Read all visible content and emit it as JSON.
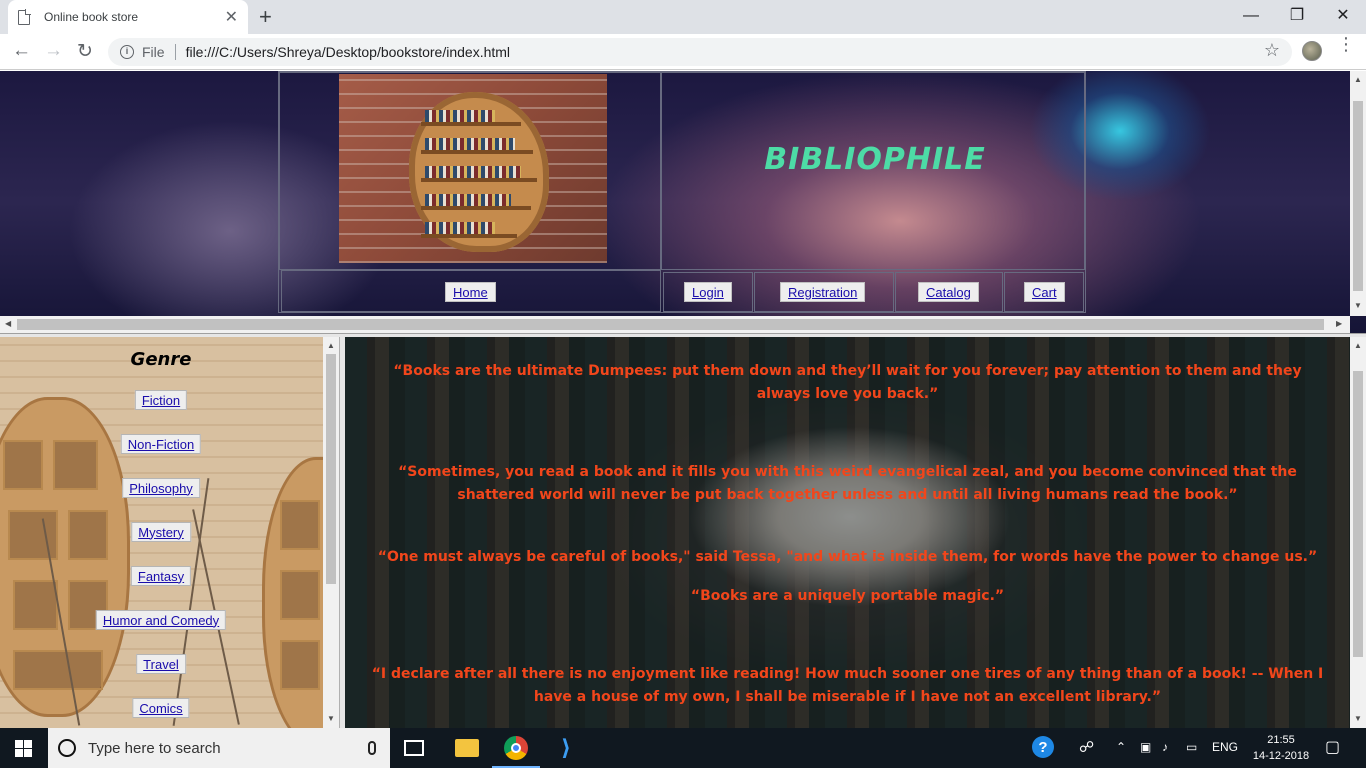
{
  "browser": {
    "tab_title": "Online book store",
    "tab_close": "✕",
    "new_tab": "+",
    "window_controls": {
      "minimize": "—",
      "restore": "❐",
      "close": "✕"
    },
    "nav": {
      "back": "←",
      "forward": "→",
      "reload": "↻"
    },
    "address": {
      "info": "i",
      "scheme_label": "File",
      "url": "file:///C:/Users/Shreya/Desktop/bookstore/index.html"
    },
    "bookmark_icon": "☆",
    "menu_icon": "⋮"
  },
  "header": {
    "site_title": "BIBLIOPHILE",
    "nav_buttons": [
      "Home",
      "Login",
      "Registration",
      "Catalog",
      "Cart"
    ]
  },
  "sidebar": {
    "title": "Genre",
    "genres": [
      "Fiction",
      "Non-Fiction",
      "Philosophy",
      "Mystery",
      "Fantasy",
      "Humor and Comedy",
      "Travel",
      "Comics"
    ]
  },
  "main": {
    "quotes": [
      "“Books are the ultimate Dumpees: put them down and they’ll wait for you forever; pay attention to them and they always love you back.”",
      "“Sometimes, you read a book and it fills you with this weird evangelical zeal, and you become convinced that the shattered world will never be put back together unless and until all living humans read the book.”",
      "“One must always be careful of books,\" said Tessa, \"and what is inside them, for words have the power to change us.”",
      "“Books are a uniquely portable magic.”",
      "“I declare after all there is no enjoyment like reading! How much sooner one tires of any thing than of a book! -- When I have a house of my own, I shall be miserable if I have not an excellent library.”"
    ]
  },
  "taskbar": {
    "search_placeholder": "Type here to search",
    "language": "ENG",
    "time": "21:55",
    "date": "14-12-2018"
  },
  "colors": {
    "title_green": "#4ddca6",
    "quote_red": "#f2461b",
    "link_blue": "#1a0dab"
  }
}
